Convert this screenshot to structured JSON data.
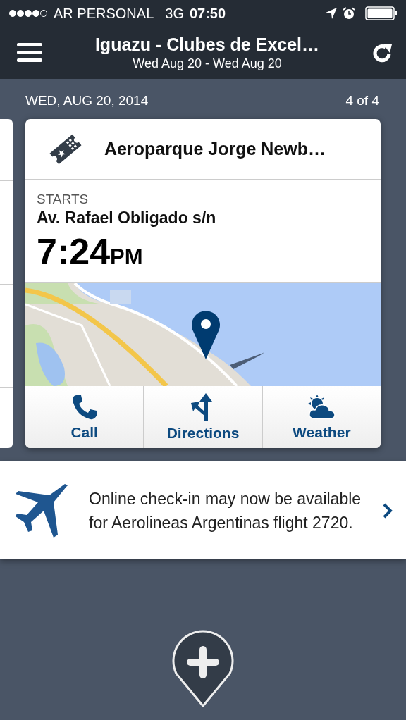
{
  "status_bar": {
    "carrier": "AR PERSONAL",
    "network": "3G",
    "time": "07:50"
  },
  "nav_bar": {
    "title": "Iguazu - Clubes de Excel…",
    "subtitle": "Wed Aug 20 - Wed Aug 20"
  },
  "day_header": {
    "date": "WED, AUG 20, 2014",
    "count": "4 of 4"
  },
  "card": {
    "title": "Aeroparque Jorge Newb…",
    "starts_label": "STARTS",
    "address": "Av. Rafael Obligado s/n",
    "time": "7:24",
    "meridiem": "PM",
    "actions": [
      {
        "kind": "call",
        "label": "Call"
      },
      {
        "kind": "directions",
        "label": "Directions"
      },
      {
        "kind": "weather",
        "label": "Weather"
      }
    ]
  },
  "notice": {
    "text": "Online check-in may now be available for Aerolineas Argentinas flight 2720."
  }
}
